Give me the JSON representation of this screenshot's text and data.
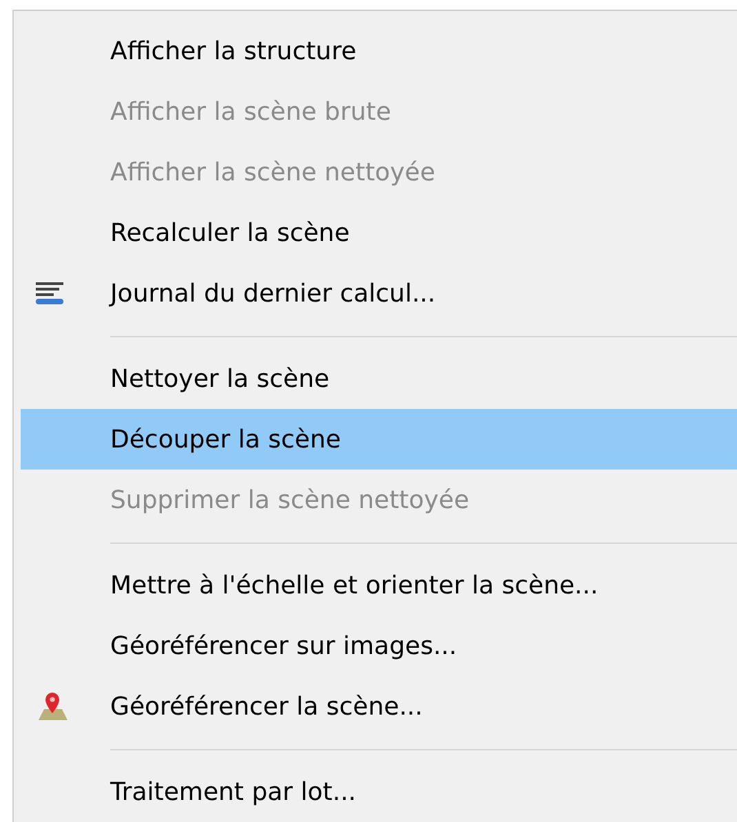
{
  "menu": {
    "items": [
      {
        "kind": "item",
        "label": "Afficher la structure",
        "disabled": false,
        "selected": false
      },
      {
        "kind": "item",
        "label": "Afficher la scène brute",
        "disabled": true,
        "selected": false
      },
      {
        "kind": "item",
        "label": "Afficher la scène nettoyée",
        "disabled": true,
        "selected": false
      },
      {
        "kind": "item",
        "label": "Recalculer la scène",
        "disabled": false,
        "selected": false
      },
      {
        "kind": "lines",
        "label": "Journal du dernier calcul...",
        "disabled": false,
        "selected": false
      },
      {
        "kind": "separator"
      },
      {
        "kind": "item",
        "label": "Nettoyer la scène",
        "disabled": false,
        "selected": false
      },
      {
        "kind": "item",
        "label": "Découper la scène",
        "disabled": false,
        "selected": true
      },
      {
        "kind": "item",
        "label": "Supprimer la scène nettoyée",
        "disabled": true,
        "selected": false
      },
      {
        "kind": "separator"
      },
      {
        "kind": "item",
        "label": "Mettre à l'échelle et orienter la scène...",
        "disabled": false,
        "selected": false
      },
      {
        "kind": "item",
        "label": "Géoréférencer sur images...",
        "disabled": false,
        "selected": false
      },
      {
        "kind": "pin",
        "label": "Géoréférencer la scène...",
        "disabled": false,
        "selected": false
      },
      {
        "kind": "separator"
      },
      {
        "kind": "item",
        "label": "Traitement par lot...",
        "disabled": false,
        "selected": false
      }
    ]
  }
}
